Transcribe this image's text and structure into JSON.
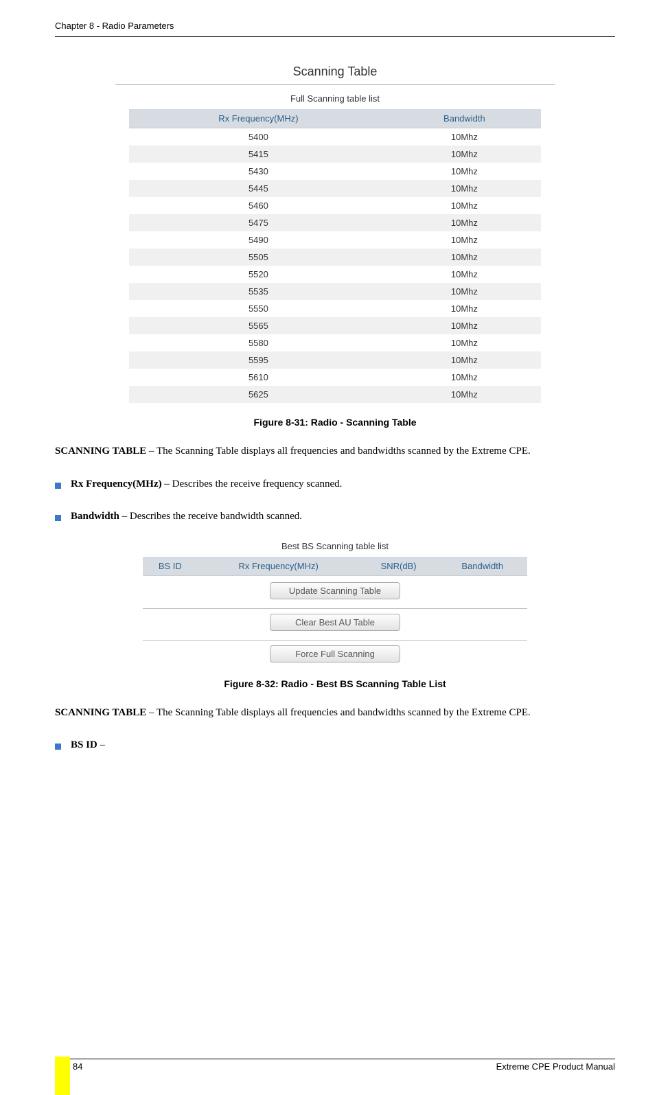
{
  "header": {
    "chapter": "Chapter 8 - Radio Parameters"
  },
  "figure1": {
    "title": "Scanning Table",
    "subtitle": "Full Scanning table list",
    "columns": [
      "Rx Frequency(MHz)",
      "Bandwidth"
    ],
    "rows": [
      [
        "5400",
        "10Mhz"
      ],
      [
        "5415",
        "10Mhz"
      ],
      [
        "5430",
        "10Mhz"
      ],
      [
        "5445",
        "10Mhz"
      ],
      [
        "5460",
        "10Mhz"
      ],
      [
        "5475",
        "10Mhz"
      ],
      [
        "5490",
        "10Mhz"
      ],
      [
        "5505",
        "10Mhz"
      ],
      [
        "5520",
        "10Mhz"
      ],
      [
        "5535",
        "10Mhz"
      ],
      [
        "5550",
        "10Mhz"
      ],
      [
        "5565",
        "10Mhz"
      ],
      [
        "5580",
        "10Mhz"
      ],
      [
        "5595",
        "10Mhz"
      ],
      [
        "5610",
        "10Mhz"
      ],
      [
        "5625",
        "10Mhz"
      ]
    ],
    "caption": "Figure 8-31: Radio - Scanning Table"
  },
  "para1": {
    "bold": "SCANNING TABLE",
    "rest": " – The Scanning Table displays all frequencies and bandwidths scanned by the Extreme CPE."
  },
  "bullet1": {
    "bold": "Rx Frequency(MHz)",
    "rest": " – Describes the receive frequency scanned."
  },
  "bullet2": {
    "bold": "Bandwidth",
    "rest": " – Describes the receive bandwidth scanned."
  },
  "figure2": {
    "subtitle": "Best BS Scanning table list",
    "columns": [
      "BS ID",
      "Rx Frequency(MHz)",
      "SNR(dB)",
      "Bandwidth"
    ],
    "buttons": {
      "update": "Update Scanning Table",
      "clear": "Clear Best AU Table",
      "force": "Force Full Scanning"
    },
    "caption": "Figure 8-32: Radio - Best BS Scanning Table List"
  },
  "para2": {
    "bold": "SCANNING TABLE",
    "rest": " – The Scanning Table displays all frequencies and bandwidths scanned by the Extreme CPE."
  },
  "bullet3": {
    "bold": "BS ID",
    "rest": " – "
  },
  "footer": {
    "page": "84",
    "manual": "Extreme CPE Product Manual"
  }
}
